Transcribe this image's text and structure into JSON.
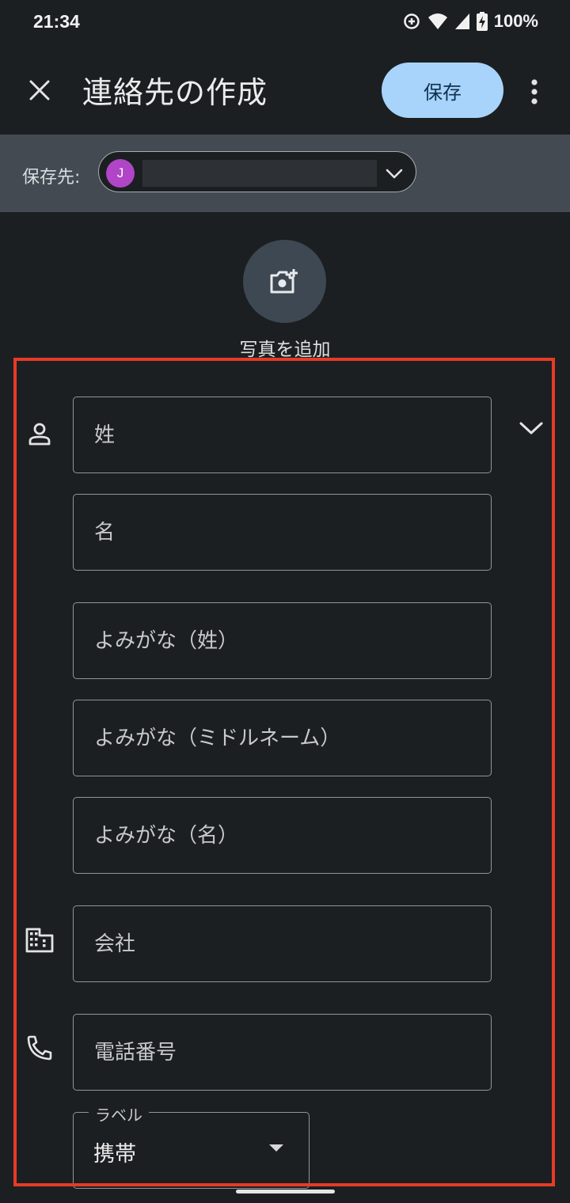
{
  "status_bar": {
    "time": "21:34",
    "battery": "100%"
  },
  "app_bar": {
    "title": "連絡先の作成",
    "save_label": "保存"
  },
  "account": {
    "label": "保存先:",
    "avatar_initial": "J"
  },
  "photo": {
    "label": "写真を追加"
  },
  "fields": {
    "last_name": "姓",
    "first_name": "名",
    "phonetic_last": "よみがな（姓）",
    "phonetic_middle": "よみがな（ミドルネーム）",
    "phonetic_first": "よみがな（名）",
    "company": "会社",
    "phone": "電話番号"
  },
  "phone_label": {
    "legend": "ラベル",
    "selected": "携帯"
  },
  "colors": {
    "accent": "#a8d4fb",
    "background": "#1c1f22",
    "avatar": "#b045c8",
    "highlight": "#e63b25"
  }
}
